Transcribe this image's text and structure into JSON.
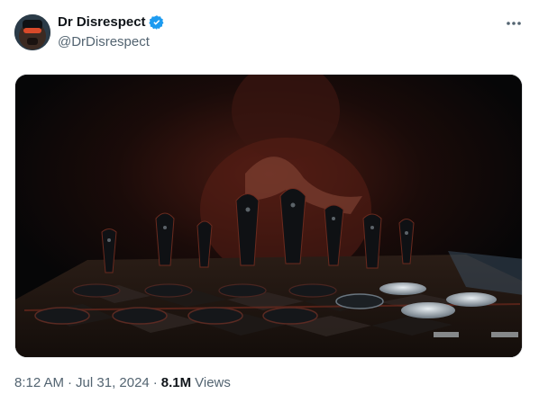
{
  "author": {
    "display_name": "Dr Disrespect",
    "handle": "@DrDisrespect",
    "verified_icon": "verified-badge-icon"
  },
  "more_icon": "more-horizontal-icon",
  "media": {
    "type": "image",
    "subject": "chess-board-photo"
  },
  "meta": {
    "time": "8:12 AM",
    "separator": "·",
    "date": "Jul 31, 2024",
    "views_count": "8.1M",
    "views_label": "Views"
  },
  "colors": {
    "verified_blue": "#1d9bf0",
    "secondary_text": "#536471",
    "primary_text": "#0f1419"
  }
}
